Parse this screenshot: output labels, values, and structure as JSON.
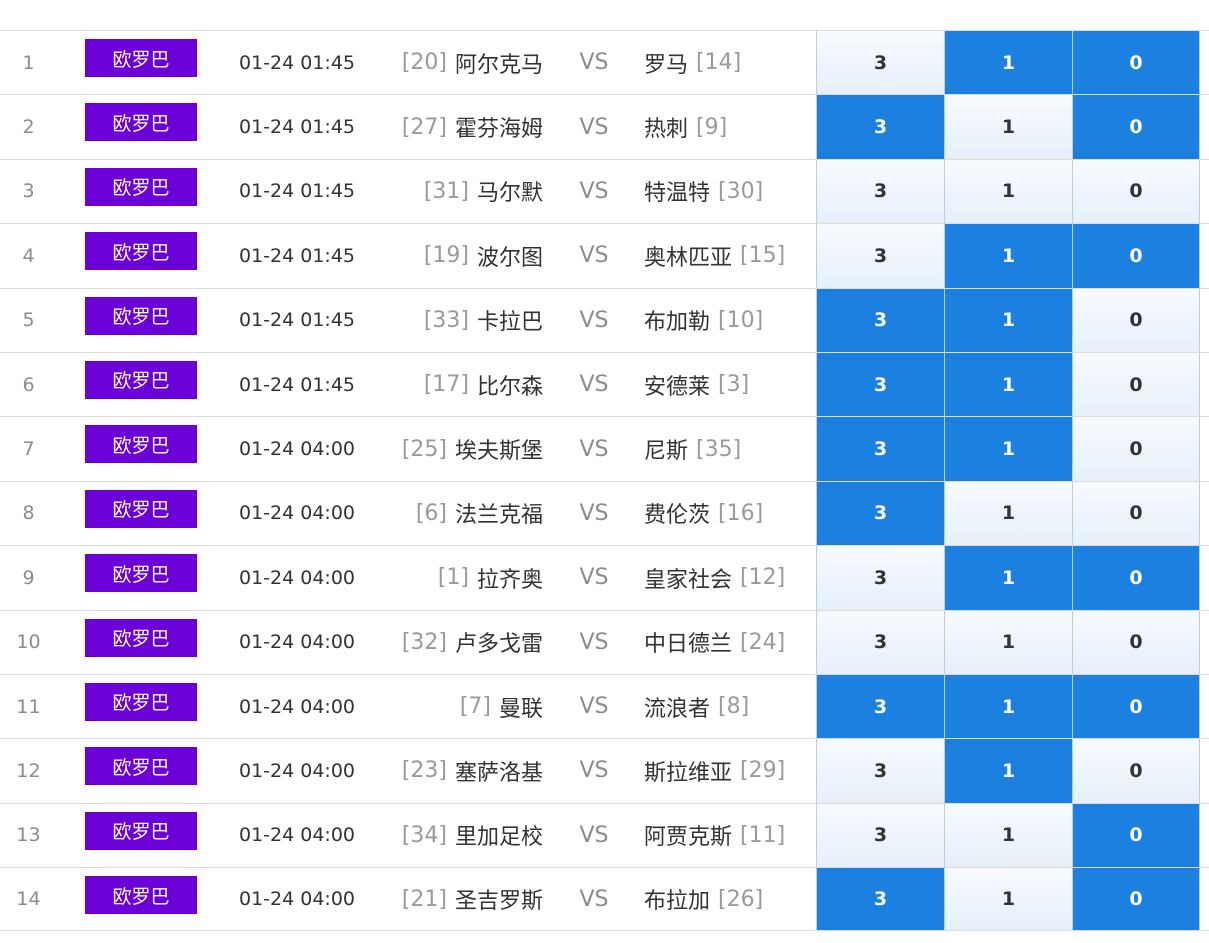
{
  "colors": {
    "league_bg": "#6b00d9",
    "selected_bg": "#1b80e0",
    "unselected_bg": "#eaf2fa"
  },
  "vs_label": "VS",
  "matches": [
    {
      "index": "1",
      "league": "欧罗巴",
      "time": "01-24 01:45",
      "home_rank": "[20]",
      "home": "阿尔克马",
      "away": "罗马",
      "away_rank": "[14]",
      "odds": [
        "3",
        "1",
        "0"
      ],
      "selected": [
        false,
        true,
        true
      ]
    },
    {
      "index": "2",
      "league": "欧罗巴",
      "time": "01-24 01:45",
      "home_rank": "[27]",
      "home": "霍芬海姆",
      "away": "热刺",
      "away_rank": "[9]",
      "odds": [
        "3",
        "1",
        "0"
      ],
      "selected": [
        true,
        false,
        true
      ]
    },
    {
      "index": "3",
      "league": "欧罗巴",
      "time": "01-24 01:45",
      "home_rank": "[31]",
      "home": "马尔默",
      "away": "特温特",
      "away_rank": "[30]",
      "odds": [
        "3",
        "1",
        "0"
      ],
      "selected": [
        false,
        false,
        false
      ]
    },
    {
      "index": "4",
      "league": "欧罗巴",
      "time": "01-24 01:45",
      "home_rank": "[19]",
      "home": "波尔图",
      "away": "奥林匹亚",
      "away_rank": "[15]",
      "odds": [
        "3",
        "1",
        "0"
      ],
      "selected": [
        false,
        true,
        true
      ]
    },
    {
      "index": "5",
      "league": "欧罗巴",
      "time": "01-24 01:45",
      "home_rank": "[33]",
      "home": "卡拉巴",
      "away": "布加勒",
      "away_rank": "[10]",
      "odds": [
        "3",
        "1",
        "0"
      ],
      "selected": [
        true,
        true,
        false
      ]
    },
    {
      "index": "6",
      "league": "欧罗巴",
      "time": "01-24 01:45",
      "home_rank": "[17]",
      "home": "比尔森",
      "away": "安德莱",
      "away_rank": "[3]",
      "odds": [
        "3",
        "1",
        "0"
      ],
      "selected": [
        true,
        true,
        false
      ]
    },
    {
      "index": "7",
      "league": "欧罗巴",
      "time": "01-24 04:00",
      "home_rank": "[25]",
      "home": "埃夫斯堡",
      "away": "尼斯",
      "away_rank": "[35]",
      "odds": [
        "3",
        "1",
        "0"
      ],
      "selected": [
        true,
        true,
        false
      ]
    },
    {
      "index": "8",
      "league": "欧罗巴",
      "time": "01-24 04:00",
      "home_rank": "[6]",
      "home": "法兰克福",
      "away": "费伦茨",
      "away_rank": "[16]",
      "odds": [
        "3",
        "1",
        "0"
      ],
      "selected": [
        true,
        false,
        false
      ]
    },
    {
      "index": "9",
      "league": "欧罗巴",
      "time": "01-24 04:00",
      "home_rank": "[1]",
      "home": "拉齐奥",
      "away": "皇家社会",
      "away_rank": "[12]",
      "odds": [
        "3",
        "1",
        "0"
      ],
      "selected": [
        false,
        true,
        true
      ]
    },
    {
      "index": "10",
      "league": "欧罗巴",
      "time": "01-24 04:00",
      "home_rank": "[32]",
      "home": "卢多戈雷",
      "away": "中日德兰",
      "away_rank": "[24]",
      "odds": [
        "3",
        "1",
        "0"
      ],
      "selected": [
        false,
        false,
        false
      ]
    },
    {
      "index": "11",
      "league": "欧罗巴",
      "time": "01-24 04:00",
      "home_rank": "[7]",
      "home": "曼联",
      "away": "流浪者",
      "away_rank": "[8]",
      "odds": [
        "3",
        "1",
        "0"
      ],
      "selected": [
        true,
        true,
        true
      ]
    },
    {
      "index": "12",
      "league": "欧罗巴",
      "time": "01-24 04:00",
      "home_rank": "[23]",
      "home": "塞萨洛基",
      "away": "斯拉维亚",
      "away_rank": "[29]",
      "odds": [
        "3",
        "1",
        "0"
      ],
      "selected": [
        false,
        true,
        false
      ]
    },
    {
      "index": "13",
      "league": "欧罗巴",
      "time": "01-24 04:00",
      "home_rank": "[34]",
      "home": "里加足校",
      "away": "阿贾克斯",
      "away_rank": "[11]",
      "odds": [
        "3",
        "1",
        "0"
      ],
      "selected": [
        false,
        false,
        true
      ]
    },
    {
      "index": "14",
      "league": "欧罗巴",
      "time": "01-24 04:00",
      "home_rank": "[21]",
      "home": "圣吉罗斯",
      "away": "布拉加",
      "away_rank": "[26]",
      "odds": [
        "3",
        "1",
        "0"
      ],
      "selected": [
        true,
        false,
        true
      ]
    }
  ]
}
